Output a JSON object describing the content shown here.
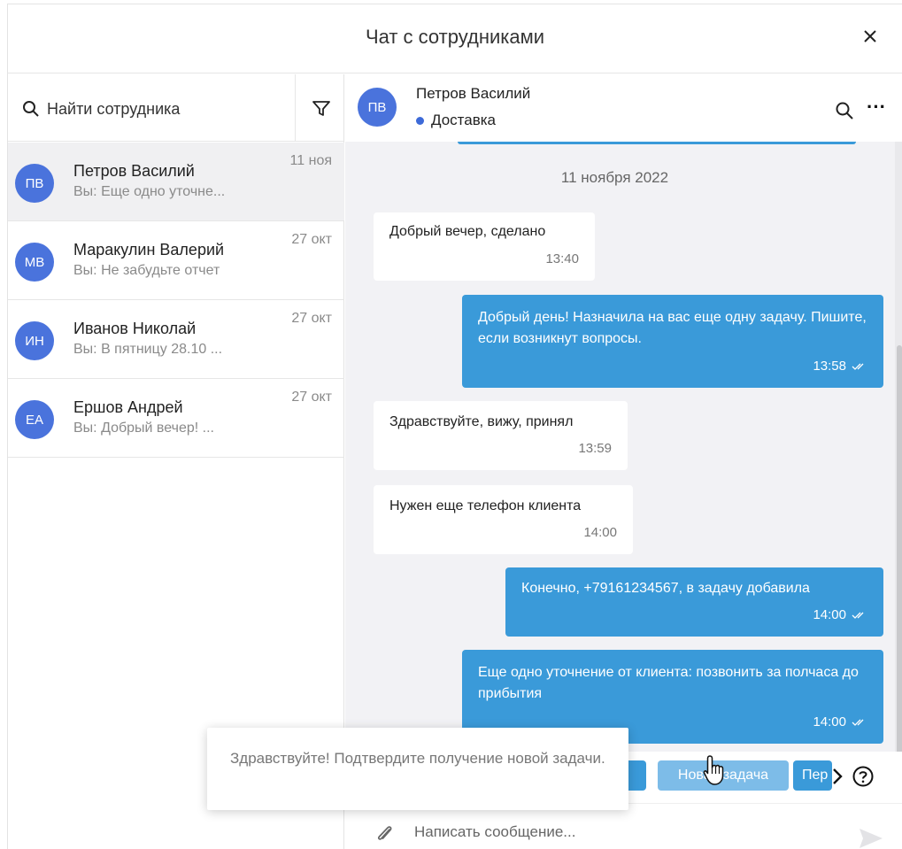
{
  "window": {
    "title": "Чат с сотрудниками"
  },
  "sidebar": {
    "search_placeholder": "Найти сотрудника",
    "contacts": [
      {
        "initials": "ПВ",
        "name": "Петров Василий",
        "preview": "Вы: Еще одно уточне...",
        "date": "11 ноя",
        "active": true
      },
      {
        "initials": "МВ",
        "name": "Маракулин Валерий",
        "preview": "Вы: Не забудьте отчет",
        "date": "27 окт"
      },
      {
        "initials": "ИН",
        "name": "Иванов Николай",
        "preview": "Вы: В пятницу 28.10 ...",
        "date": "27 окт"
      },
      {
        "initials": "ЕА",
        "name": "Ершов Андрей",
        "preview": "Вы: Добрый вечер! ...",
        "date": "27 окт"
      }
    ]
  },
  "chat": {
    "header": {
      "initials": "ПВ",
      "name": "Петров Василий",
      "status": "Доставка",
      "status_color": "#3d6ad8"
    },
    "date_separator": "11 ноября 2022",
    "messages": [
      {
        "dir": "in",
        "text": "Добрый вечер, сделано",
        "time": "13:40"
      },
      {
        "dir": "out",
        "text": "Добрый день! Назначила на вас еще одну задачу. Пишите, если возникнут вопросы.",
        "time": "13:58"
      },
      {
        "dir": "in",
        "text": "Здравствуйте, вижу, принял",
        "time": "13:59"
      },
      {
        "dir": "in",
        "text": "Нужен еще телефон клиента",
        "time": "14:00"
      },
      {
        "dir": "out",
        "text": "Конечно, +79161234567, в задачу добавила",
        "time": "14:00"
      },
      {
        "dir": "out",
        "text": "Еще одно уточнение от клиента: позвонить за полчаса до прибытия",
        "time": "14:00"
      }
    ],
    "quick_replies": [
      "Новая задача",
      "Пер"
    ],
    "composer_placeholder": "Написать сообщение..."
  },
  "tooltip": {
    "text": "Здравствуйте! Подтвердите получение новой задачи."
  },
  "colors": {
    "accent": "#3a9ad9",
    "avatar": "#4a73dc",
    "chat_bg": "#f2f2f5"
  }
}
